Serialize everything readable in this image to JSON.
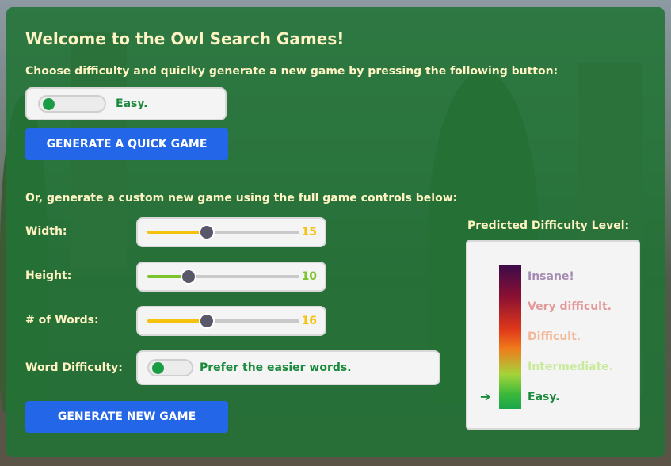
{
  "title": "Welcome to the Owl Search Games!",
  "quick": {
    "instruction": "Choose difficulty and quiclky generate a new game by pressing the following button:",
    "toggle_label": "Easy.",
    "button_label": "GENERATE A QUICK GAME"
  },
  "custom": {
    "heading": "Or, generate a custom new game using the full game controls below:",
    "width": {
      "label": "Width:",
      "value": "15",
      "fraction": 0.39,
      "color": "#f4c20d"
    },
    "height": {
      "label": "Height:",
      "value": "10",
      "fraction": 0.27,
      "color": "#7cc42a"
    },
    "words": {
      "label": "# of Words:",
      "value": "16",
      "fraction": 0.39,
      "color": "#f4c20d"
    },
    "word_difficulty": {
      "label": "Word Difficulty:",
      "toggle_label": "Prefer the easier words."
    },
    "button_label": "GENERATE NEW GAME"
  },
  "predicted": {
    "title": "Predicted Difficulty Level:",
    "levels": [
      {
        "label": "Insane!",
        "color": "#a68cb2"
      },
      {
        "label": "Very difficult.",
        "color": "#e39a9a"
      },
      {
        "label": "Difficult.",
        "color": "#f2b89a"
      },
      {
        "label": "Intermediate.",
        "color": "#c8ea9a"
      },
      {
        "label": "Easy.",
        "color": "#1a8a3c"
      }
    ],
    "current": "Easy.",
    "arrow": "➔"
  }
}
